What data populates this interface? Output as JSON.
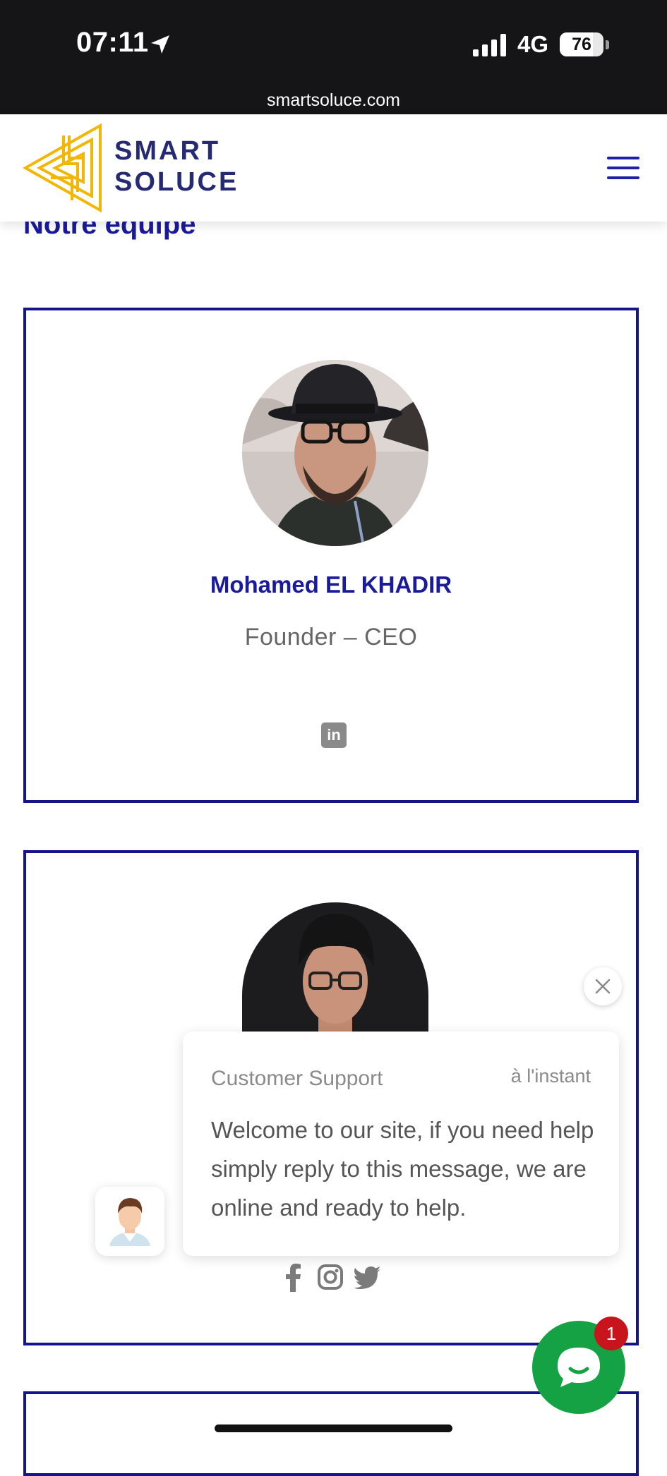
{
  "status_bar": {
    "time": "07:11",
    "network": "4G",
    "battery": "76",
    "battery_level": 0.76,
    "url": "smartsoluce.com"
  },
  "header": {
    "logo_line1": "SMART",
    "logo_line2": "SOLUCE",
    "menu_icon": "hamburger-menu-icon",
    "brand_color": "#262a74",
    "logo_color": "#f2b705"
  },
  "section": {
    "title": "Notre équipe"
  },
  "team": [
    {
      "name": "Mohamed EL KHADIR",
      "role": "Founder – CEO",
      "socials": [
        "linkedin-icon"
      ]
    },
    {
      "socials": [
        "facebook-icon",
        "instagram-icon",
        "twitter-icon"
      ]
    }
  ],
  "chat": {
    "sender": "Customer Support",
    "time": "à l'instant",
    "message": "Welcome to our site, if you need help simply reply to this message, we are online and ready to help.",
    "unread_count": "1",
    "launcher_color": "#14a244",
    "badge_color": "#c8141c"
  },
  "colors": {
    "accent": "#14148e",
    "title": "#1a1a9c"
  }
}
